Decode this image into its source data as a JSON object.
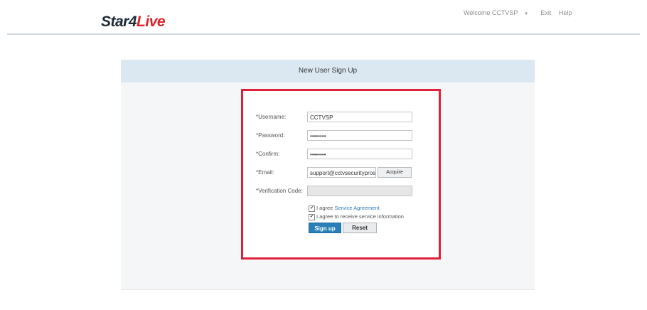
{
  "brand": {
    "part1": "Star4",
    "part2": "Live"
  },
  "top_nav": {
    "welcome": "Welcome CCTVSP",
    "exit": "Exit",
    "help": "Help"
  },
  "panel": {
    "title": "New User Sign Up"
  },
  "form": {
    "username_label": "*Username:",
    "username_value": "CCTVSP",
    "password_label": "*Password:",
    "password_value": "••••••••",
    "confirm_label": "*Confirm:",
    "confirm_value": "••••••••",
    "email_label": "*Email:",
    "email_value": "support@cctvsecuritypros.co",
    "acquire_label": "Acquire",
    "verification_label": "*Verification Code:",
    "verification_value": "",
    "agree_text": "I agree ",
    "agree_link": "Service Agreement",
    "agree_checked": true,
    "receive_text": "I agree to receive service information",
    "receive_checked": true,
    "signup_label": "Sign up",
    "reset_label": "Reset"
  },
  "colors": {
    "highlight_border": "#e0203a",
    "panel_header_bg": "#dbe8f1",
    "signup_bg": "#2a7fb8",
    "brand_red": "#d9242b"
  }
}
